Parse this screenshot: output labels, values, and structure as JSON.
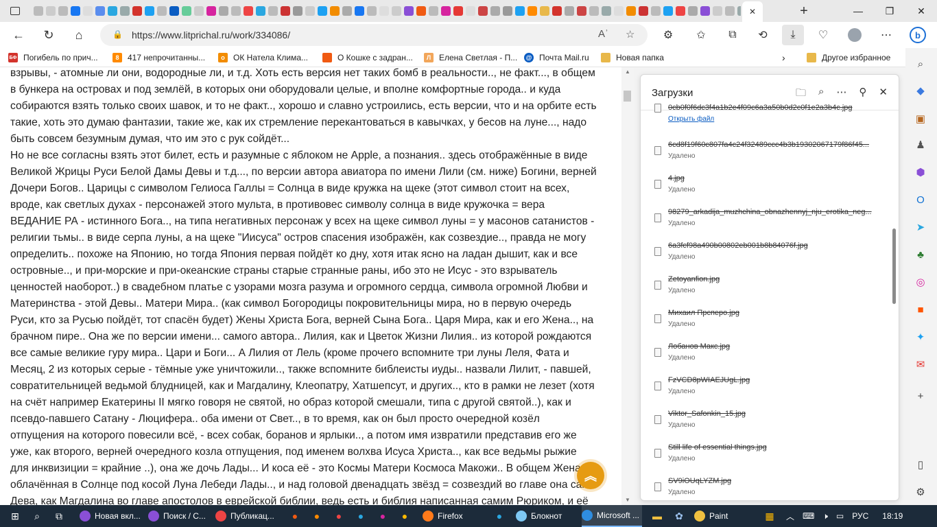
{
  "browser": {
    "url": "https://www.litprichal.ru/work/334086/",
    "active_tab_close": "✕",
    "new_tab": "+"
  },
  "favorites": [
    {
      "label": "Погибель по прич...",
      "color": "#d3332c",
      "glyph": "БФ"
    },
    {
      "label": "417 непрочитанны...",
      "color": "#ff8a00",
      "glyph": "8"
    },
    {
      "label": "ОК Натела Клима...",
      "color": "#f28c00",
      "glyph": "o"
    },
    {
      "label": "О Кошке с задран...",
      "color": "#f05a12",
      "glyph": ""
    },
    {
      "label": "Елена Светлая - П...",
      "color": "#f2a65a",
      "glyph": "Л"
    },
    {
      "label": "Почта Mail.ru",
      "color": "#0a5cc2",
      "glyph": "@"
    },
    {
      "label": "Новая папка",
      "color": "#e8b84a",
      "glyph": ""
    },
    {
      "label": "Другое избранное",
      "color": "#e8b84a",
      "glyph": ""
    }
  ],
  "article": {
    "lines": [
      "взрывы, - атомные ли они, водородные ли, и т.д. Хоть есть версия нет таких бомб в реальности.., не факт..., в общем",
      "в бункера на островах и под землёй, в которых они оборудовали целые, и вполне комфортные города.. и куда",
      "собираются взять только своих шавок, и то не факт.., хорошо и славно устроились, есть версии, что и на орбите есть",
      "такие, хоть это думаю фантазии, такие же, как их стремление перекантоваться в кавычках, у бесов на луне..., надо",
      "быть совсем безумным думая, что им это с рук сойдёт...",
      "Но не все согласны взять этот билет, есть и разумные с яблоком не Apple, а познания.. здесь отображённые в виде",
      "Великой Жрицы Руси Белой Дамы Девы и т.д..., по версии автора авиатора по имени Лили (см. ниже) Богини, верней",
      "Дочери Богов.. Царицы с символом Гелиоса Галлы = Солнца в виде кружка на щеке (этот символ стоит на всех,",
      "вроде, как светлых духах - персонажей этого мульта, в противовес символу солнца в виде кружочка = вера",
      "ВЕДАНИЕ РА - истинного Бога.., на типа негативных персонаж у всех на щеке символ луны = у масонов сатанистов -",
      "религии тьмы.. в виде серпа луны, а на щеке \"Иисуса\" остров спасения изображён, как созвездие.., правда не могу",
      "определить.. похоже на Японию, но тогда Япония первая пойдёт ко дну, хотя итак ясно на ладан дышит, как и все",
      "островные.., и при-морские и при-океанские страны старые странные раны, ибо это не Исус - это взрыватель",
      "ценностей наоборот..) в свадебном платье с узорами мозга разума и огромного сердца, символа огромной Любви и",
      "Материнства - этой Девы.. Матери Мира.. (как символ Богородицы покровительницы мира, но в первую очередь",
      "Руси, кто за Русью пойдёт, тот спасён будет) Жены Христа Бога, верней Сына Бога.. Царя Мира, как и его Жена.., на",
      "брачном пире.. Она же по версии имени... самого автора.. Лилия, как и Цветок Жизни Лилия.. из которой рождаются",
      "все самые великие гуру мира.. Цари и Боги... А Лилия от Лель (кроме прочего вспомните три луны Леля, Фата и",
      "Месяц, 2 из которых серые - тёмные уже уничтожили.., также вспомните библеисты иуды.. назвали Лилит, - павшей,",
      "совратительницей ведьмой блудницей, как и Магдалину, Клеопатру, Хатшепсут, и других.., кто в рамки не лезет (хотя",
      "на счёт например Екатерины II мягко говоря не святой, но образ которой смешали, типа с другой святой..), как и",
      "псевдо-павшего Сатану - Люцифера.. оба имени от Свет.., в то время, как он был просто очередной козёл",
      "отпущения на которого повесили всё, - всех собак, боранов и ярлыки.., а потом имя извратили представив его же",
      "уже, как второго, верней очередного козла отпущения, под именем волхва Исуса Христа.., как все ведьмы рыжие",
      "для инквизиции = крайние ..), она же дочь Лады... И коса её - это Космы Матери Космоса Макожи.. В общем Жена",
      "облачённая в Солнце под косой Луна Лебеди Лады.., и над головой двенадцать звёзд = созвездий во главе она сама",
      "Дева, как Магдалина во главе апостолов в еврейской библии, ведь есть и библия написанная самим Рюриком, и её"
    ]
  },
  "downloads": {
    "title": "Загрузки",
    "open_file": "Открыть файл",
    "top_partial": "0cb0f0f6dc3f4a1b2e4f09c6a3a50b0d2c0f1e2a3b4c.jpg",
    "items": [
      {
        "name": "6cd8f19f60c807fa4c24f32489ccc4b3b19302067179f86f45...",
        "status": "Удалено"
      },
      {
        "name": "4.jpg",
        "status": "Удалено"
      },
      {
        "name": "98279_arkadija_muzhchina_obnazhennyj_nju_erotika_neg...",
        "status": "Удалено"
      },
      {
        "name": "6a3fcf98a490b00802eb001b8b84076f.jpg",
        "status": "Удалено"
      },
      {
        "name": "Zetoyanfion.jpg",
        "status": "Удалено"
      },
      {
        "name": "Михаил Прсперо.jpg",
        "status": "Удалено"
      },
      {
        "name": "Лобанов Макс.jpg",
        "status": "Удалено"
      },
      {
        "name": "FzVCD8pWIAEJUgL.jpg",
        "status": "Удалено"
      },
      {
        "name": "Viktor_Safonkin_15.jpg",
        "status": "Удалено"
      },
      {
        "name": "Still life of essential things.jpg",
        "status": "Удалено"
      },
      {
        "name": "SV9iOUqLYZM.jpg",
        "status": "Удалено"
      }
    ]
  },
  "taskbar": {
    "apps": [
      {
        "label": "Новая вкл...",
        "color": "#8a4fd6"
      },
      {
        "label": "Поиск / С...",
        "color": "#8a4fd6"
      },
      {
        "label": "Публикац...",
        "color": "#e44"
      },
      {
        "label": "Firefox",
        "color": "#ff7a1a"
      },
      {
        "label": "Блокнот",
        "color": "#7ec8f3"
      },
      {
        "label": "Microsoft ...",
        "color": "#2f8de0"
      },
      {
        "label": "Paint",
        "color": "#f0c040"
      }
    ],
    "lang": "РУС",
    "time": "18:19"
  },
  "colors": {
    "accent": "#0a5cc2",
    "scroll_top": "#e69b12",
    "taskbar": "#1c2b3a"
  }
}
